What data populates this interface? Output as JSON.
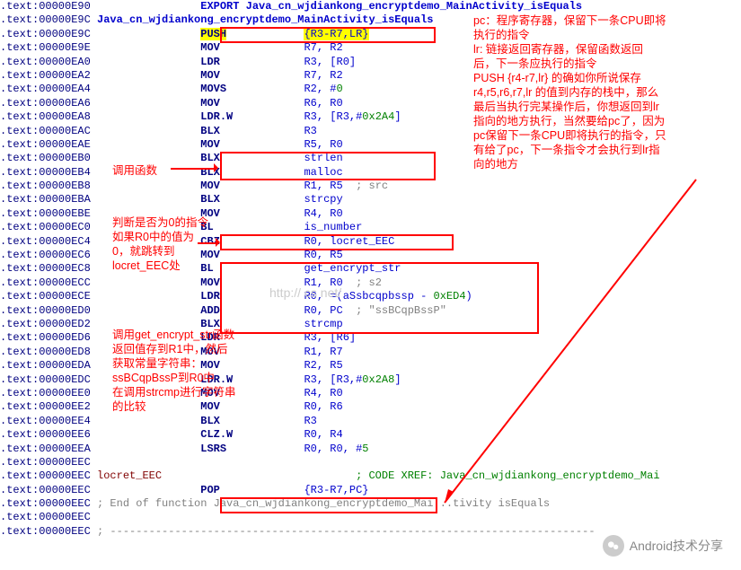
{
  "watermark": "http://        cs   net/",
  "wechat_label": "Android技术分享",
  "annotations": {
    "call_func": "调用函数",
    "cbz_note": "判断是否为0的指令\n如果R0中的值为\n0，就跳转到\nlocret_EEC处",
    "encrypt_note": "调用get_encrypt_str函数\n返回值存到R1中，然后\n获取常量字符串：\nssBCqpBssP到R0中\n在调用strcmp进行字符串\n的比较",
    "pc_note": "pc：程序寄存器，保留下一条CPU即将\n执行的指令\nlr: 链接返回寄存器，保留函数返回\n后，下一条应执行的指令\nPUSH {r4-r7,lr} 的确如你所说保存\nr4,r5,r6,r7,lr 的值到内存的栈中，那么\n最后当执行完某操作后，你想返回到lr\n指向的地方执行，当然要给pc了，因为\npc保留下一条CPU即将执行的指令，只\n有给了pc，下一条指令才会执行到lr指\n向的地方"
  },
  "lines": [
    {
      "addr": ".text:00000E90",
      "body": "                 EXPORT Java_cn_wjdiankong_encryptdemo_MainActivity_isEquals",
      "navy": true
    },
    {
      "addr": ".text:00000E9C",
      "body": " Java_cn_wjdiankong_encryptdemo_MainActivity_isEquals",
      "navy": true
    },
    {
      "addr": ".text:00000E9C",
      "body": "                 PUSH            {R3-R7,LR}",
      "hl": true
    },
    {
      "addr": ".text:00000E9E",
      "body": "                 MOV             R7, R2"
    },
    {
      "addr": ".text:00000EA0",
      "body": "                 LDR             R3, [R0]"
    },
    {
      "addr": ".text:00000EA2",
      "body": "                 MOV             R7, R2"
    },
    {
      "addr": ".text:00000EA4",
      "body": "                 MOVS            R2, #0",
      "green_part": "0"
    },
    {
      "addr": ".text:00000EA6",
      "body": "                 MOV             R6, R0"
    },
    {
      "addr": ".text:00000EA8",
      "body": "                 LDR.W           R3, [R3,#0x2A4]",
      "green_part": "0x2A4"
    },
    {
      "addr": ".text:00000EAC",
      "body": "                 BLX             R3"
    },
    {
      "addr": ".text:00000EAE",
      "body": "                 MOV             R5, R0"
    },
    {
      "addr": ".text:00000EB0",
      "body": "                 BLX             strlen"
    },
    {
      "addr": ".text:00000EB4",
      "body": "                 BLX             malloc"
    },
    {
      "addr": ".text:00000EB8",
      "body": "                 MOV             R1, R5  ; src",
      "cmt": "; src"
    },
    {
      "addr": ".text:00000EBA",
      "body": "                 BLX             strcpy"
    },
    {
      "addr": ".text:00000EBE",
      "body": "                 MOV             R4, R0"
    },
    {
      "addr": ".text:00000EC0",
      "body": "                 BL              is_number"
    },
    {
      "addr": ".text:00000EC4",
      "body": "                 CBZ             R0, locret_EEC"
    },
    {
      "addr": ".text:00000EC6",
      "body": "                 MOV             R0, R5"
    },
    {
      "addr": ".text:00000EC8",
      "body": "                 BL              get_encrypt_str"
    },
    {
      "addr": ".text:00000ECC",
      "body": "                 MOV             R1, R0  ; s2",
      "cmt": "; s2"
    },
    {
      "addr": ".text:00000ECE",
      "body": "                 LDR             R0, =(aSsbcqpbssp - 0xED4)",
      "green_part": "0xED4"
    },
    {
      "addr": ".text:00000ED0",
      "body": "                 ADD             R0, PC  ; \"ssBCqpBssP\"",
      "cmt": "; \"ssBCqpBssP\""
    },
    {
      "addr": ".text:00000ED2",
      "body": "                 BLX             strcmp"
    },
    {
      "addr": ".text:00000ED6",
      "body": "                 LDR             R3, [R6]"
    },
    {
      "addr": ".text:00000ED8",
      "body": "                 MOV             R1, R7"
    },
    {
      "addr": ".text:00000EDA",
      "body": "                 MOV             R2, R5"
    },
    {
      "addr": ".text:00000EDC",
      "body": "                 LDR.W           R3, [R3,#0x2A8]",
      "green_part": "0x2A8"
    },
    {
      "addr": ".text:00000EE0",
      "body": "                 MOV             R4, R0"
    },
    {
      "addr": ".text:00000EE2",
      "body": "                 MOV             R0, R6"
    },
    {
      "addr": ".text:00000EE4",
      "body": "                 BLX             R3"
    },
    {
      "addr": ".text:00000EE6",
      "body": "                 CLZ.W           R0, R4"
    },
    {
      "addr": ".text:00000EEA",
      "body": "                 LSRS            R0, R0, #5",
      "green_part": "5"
    },
    {
      "addr": ".text:00000EEC",
      "body": ""
    },
    {
      "addr": ".text:00000EEC",
      "body": " locret_EEC                              ; CODE XREF: Java_cn_wjdiankong_encryptdemo_Mai",
      "loc": true
    },
    {
      "addr": ".text:00000EEC",
      "body": "                 POP             {R3-R7,PC}"
    },
    {
      "addr": ".text:00000EEC",
      "body": " ; End of function Java_cn_wjdiankong_encryptdemo_Mai...tivity isEquals",
      "cmt_full": true
    },
    {
      "addr": ".text:00000EEC",
      "body": ""
    },
    {
      "addr": ".text:00000EEC",
      "body": " ; ---------------------------------------------------------------------------",
      "cmt_full": true
    }
  ]
}
